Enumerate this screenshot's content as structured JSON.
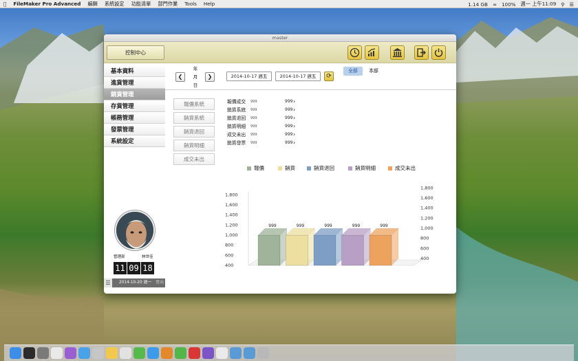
{
  "menubar": {
    "app_name": "FileMaker Pro Advanced",
    "menus": [
      "編輯",
      "系統設定",
      "功能清單",
      "部門作業",
      "Tools",
      "Help"
    ],
    "status": {
      "disk": "1.14 GB",
      "battery": "100%",
      "datetime": "週一 上午11:09"
    }
  },
  "window": {
    "title": "master",
    "control_center_label": "控制中心"
  },
  "sidebar": {
    "items": [
      {
        "label": "基本資料"
      },
      {
        "label": "進貨管理"
      },
      {
        "label": "銷貨管理"
      },
      {
        "label": "存貨管理"
      },
      {
        "label": "帳務管理"
      },
      {
        "label": "發票管理"
      },
      {
        "label": "系統設定"
      }
    ]
  },
  "nav": {
    "period_labels": [
      "年",
      "月",
      "日"
    ],
    "date_from": "2014-10-17 週五",
    "date_to": "2014-10-17 週五",
    "filter_all": "全部",
    "filter_dept": "本部"
  },
  "sub_buttons": [
    "報價系統",
    "銷貨系統",
    "銷貨退回",
    "銷貨明細",
    "成交未出"
  ],
  "stats": [
    {
      "label": "報價成交",
      "v1": "999",
      "v2": "999"
    },
    {
      "label": "銷貨系統",
      "v1": "999",
      "v2": "999"
    },
    {
      "label": "銷貨退回",
      "v1": "999",
      "v2": "999"
    },
    {
      "label": "銷貨明細",
      "v1": "999",
      "v2": "999"
    },
    {
      "label": "成交未出",
      "v1": "999",
      "v2": "999"
    },
    {
      "label": "銷貨發票",
      "v1": "999",
      "v2": "999"
    }
  ],
  "chart_data": {
    "type": "bar",
    "categories": [
      "報價",
      "銷貨",
      "銷貨退回",
      "銷貨明細",
      "成交未出"
    ],
    "values": [
      999,
      999,
      999,
      999,
      999
    ],
    "colors": [
      "#9fb49a",
      "#ecdfa0",
      "#7e9ec5",
      "#b79fc6",
      "#eda35e"
    ],
    "left_ticks": [
      "400",
      "600",
      "800",
      "1,000",
      "1,200",
      "1,400",
      "1,600",
      "1,800"
    ],
    "right_ticks": [
      "400",
      "600",
      "800",
      "1,000",
      "1,200",
      "1,400",
      "1,600",
      "1,800"
    ],
    "ylim": [
      400,
      1800
    ]
  },
  "user": {
    "department": "管理部",
    "name": "林世佳",
    "clock": [
      "11",
      "09",
      "18"
    ],
    "date": "2014-10-20 週一",
    "logout": "登出"
  }
}
